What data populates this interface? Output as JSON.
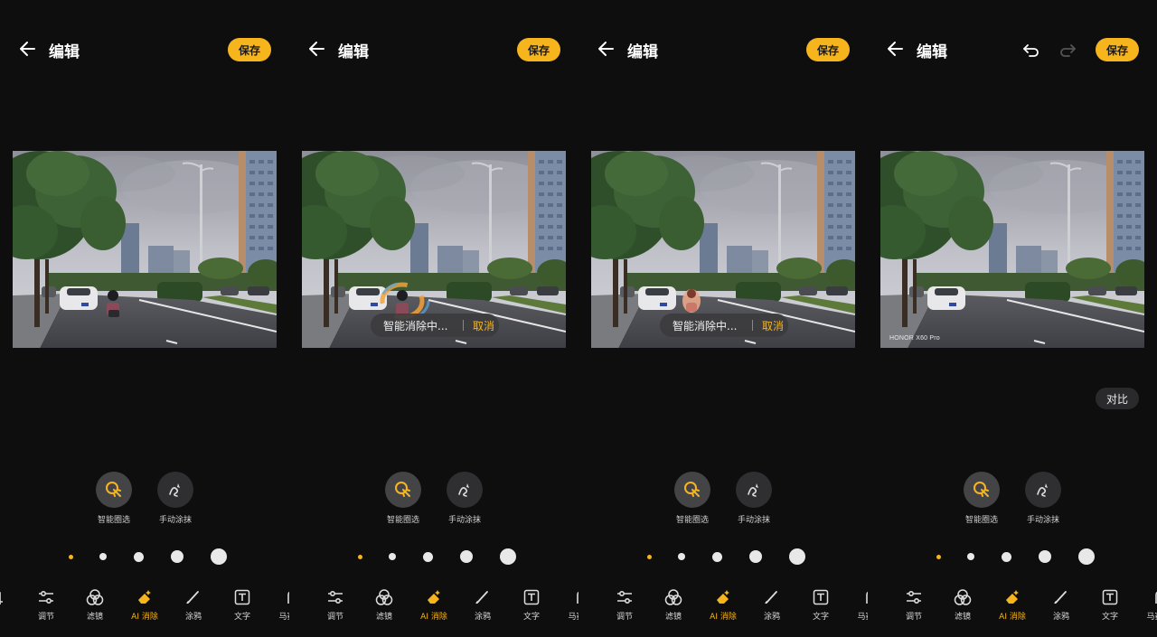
{
  "header": {
    "title": "编辑",
    "save_label": "保存"
  },
  "panels": [
    {
      "state": "initial"
    },
    {
      "state": "processing"
    },
    {
      "state": "processing"
    },
    {
      "state": "done"
    }
  ],
  "progress": {
    "text": "智能消除中...",
    "cancel_label": "取消"
  },
  "photo_watermark": "HONOR X60 Pro",
  "compare_label": "对比",
  "modes": [
    {
      "label": "智能圈选",
      "icon": "smart-select-icon",
      "active": true
    },
    {
      "label": "手动涂抹",
      "icon": "manual-smear-icon",
      "active": false
    }
  ],
  "brush_sizes": [
    "xs",
    "s",
    "m",
    "l",
    "xl"
  ],
  "tools": [
    {
      "label": "剪",
      "icon": "crop-icon"
    },
    {
      "label": "调节",
      "icon": "adjust-icon"
    },
    {
      "label": "滤镜",
      "icon": "filter-icon"
    },
    {
      "label": "AI 消除",
      "icon": "ai-eraser-icon",
      "active": true
    },
    {
      "label": "涂鸦",
      "icon": "brush-icon"
    },
    {
      "label": "文字",
      "icon": "text-icon"
    },
    {
      "label": "马赛克",
      "icon": "mosaic-icon"
    }
  ],
  "colors": {
    "accent": "#f6b51d",
    "background": "#0e0e0f"
  }
}
